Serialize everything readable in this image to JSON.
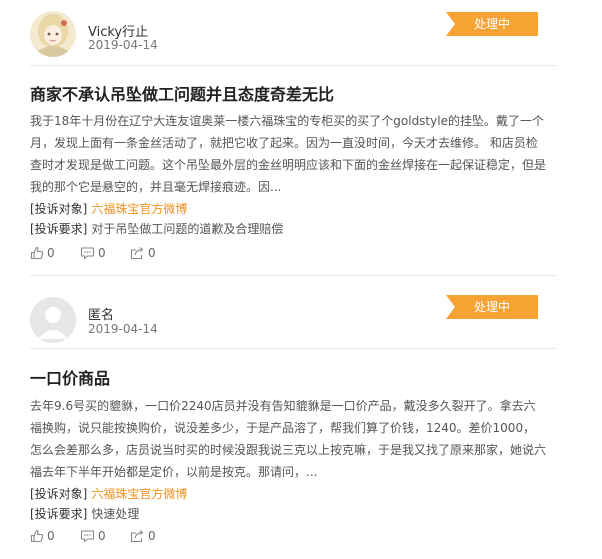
{
  "complaints": [
    {
      "user": "Vicky行止",
      "date": "2019-04-14",
      "status": "处理中",
      "title": "商家不承认吊坠做工问题并且态度奇差无比",
      "body": "我于18年十月份在辽宁大连友谊奥莱一楼六福珠宝的专柜买的买了个goldstyle的挂坠。戴了一个月，发现上面有一条金丝活动了，就把它收了起来。因为一直没时间，今天才去维修。 和店员检查时才发现是做工问题。这个吊坠最外层的金丝明明应该和下面的金丝焊接在一起保证稳定，但是我的那个它是悬空的，并且毫无焊接痕迹。因...",
      "target_label": "[投诉对象]",
      "target": "六福珠宝官方微博",
      "request_label": "[投诉要求]",
      "request": "对于吊坠做工问题的道歉及合理赔偿",
      "likes": "0",
      "comments": "0",
      "shares": "0"
    },
    {
      "user": "匿名",
      "date": "2019-04-14",
      "status": "处理中",
      "title": "一口价商品",
      "body": "去年9.6号买的貔貅，一口价2240店员并没有告知貔貅是一口价产品，戴没多久裂开了。拿去六福换购，说只能按换购价，说没差多少，于是产品溶了，帮我们算了价钱，1240。差价1000，怎么会差那么多，店员说当时买的时候没跟我说三克以上按克嘛，于是我又找了原来那家，她说六福去年下半年开始都是定价，以前是按克。那请问，...",
      "target_label": "[投诉对象]",
      "target": "六福珠宝官方微博",
      "request_label": "[投诉要求]",
      "request": "快速处理",
      "likes": "0",
      "comments": "0",
      "shares": "0"
    }
  ],
  "colors": {
    "accent": "#f7a334",
    "link": "#f0901e"
  }
}
